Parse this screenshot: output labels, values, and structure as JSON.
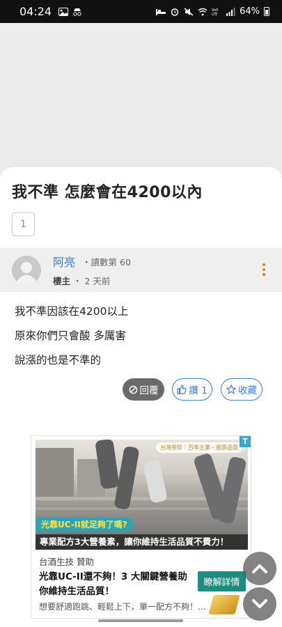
{
  "status_bar": {
    "time": "04:24",
    "left_icons": [
      "image-icon",
      "incognito-icon"
    ],
    "right_icons": [
      "bed-icon",
      "alarm-icon",
      "mute-icon",
      "wifi-icon",
      "volte-icon",
      "signal-icon"
    ],
    "battery": "64%",
    "battery_level": 0.64
  },
  "post": {
    "title": "我不準 怎麼會在4200以內",
    "page_number": "1"
  },
  "author": {
    "name": "阿亮",
    "read_count": "・讀數第 60",
    "role": "樓主",
    "separator": "・",
    "time_ago": "2 天前"
  },
  "content": {
    "lines": [
      "我不準因該在4200以上",
      "原來你們只會酸 多厲害",
      "說漲的也是不準的"
    ]
  },
  "actions": {
    "reply_label": "回覆",
    "like_label": "讚 1",
    "favorite_label": "收藏"
  },
  "ad": {
    "badge": "台灣茶珍｜百年企業・國貨品質",
    "corner": "T",
    "tag": "光靠UC-II就足夠了嗎?",
    "banner": "專業配方3大營養素，讓你維持生活品質不費力！",
    "sponsor": "台酒生技 贊助",
    "headline": "光靠UC-II還不夠！3 大關鍵營養助你維持生活品質！",
    "cta": "瞭解詳情",
    "description": "想要舒適跑跳、輕鬆上下，單一配方不夠！..."
  },
  "colors": {
    "accent_blue": "#3a7bd5",
    "cta_green": "#1e8c7e",
    "tag_teal": "#2fa3b3",
    "tag_yellow": "#ffe34a"
  }
}
